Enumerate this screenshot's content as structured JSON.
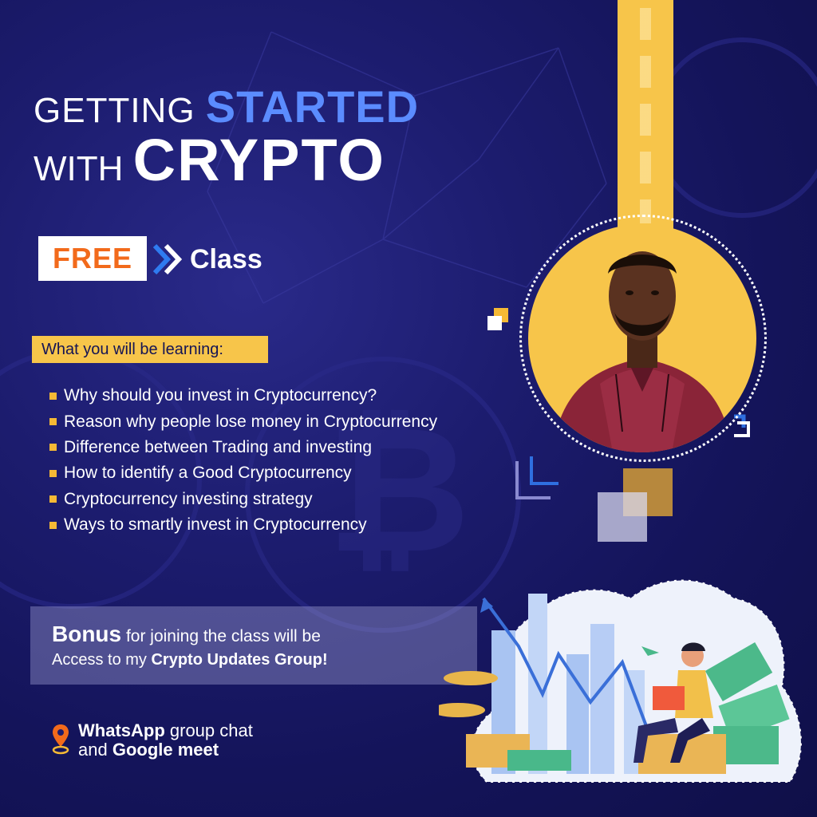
{
  "title": {
    "line1_prefix": "GETTING",
    "line1_highlight": "STARTED",
    "line2_prefix": "WITH",
    "line2_highlight": "CRYPTO"
  },
  "free_class": {
    "badge": "FREE",
    "label": "Class"
  },
  "learning": {
    "heading": "What you will be learning:",
    "items": [
      "Why should you invest in Cryptocurrency?",
      "Reason why people lose money in Cryptocurrency",
      "Difference between Trading and investing",
      "How to identify a Good Cryptocurrency",
      "Cryptocurrency investing strategy",
      "Ways to smartly invest in Cryptocurrency"
    ]
  },
  "bonus": {
    "bold_word": "Bonus",
    "line1_rest": " for joining the class will be",
    "line2_prefix": "Access to my ",
    "line2_bold": "Crypto Updates Group!"
  },
  "platform": {
    "bold1": "WhatsApp",
    "rest1": " group chat",
    "prefix2": "and ",
    "bold2": "Google meet"
  },
  "colors": {
    "background": "#1c1c6e",
    "accent_yellow": "#f7c54a",
    "accent_blue": "#5b8cff",
    "free_orange": "#f26a1b"
  },
  "icons": {
    "chevron": "double-chevron-right-icon",
    "location": "location-pin-icon"
  }
}
